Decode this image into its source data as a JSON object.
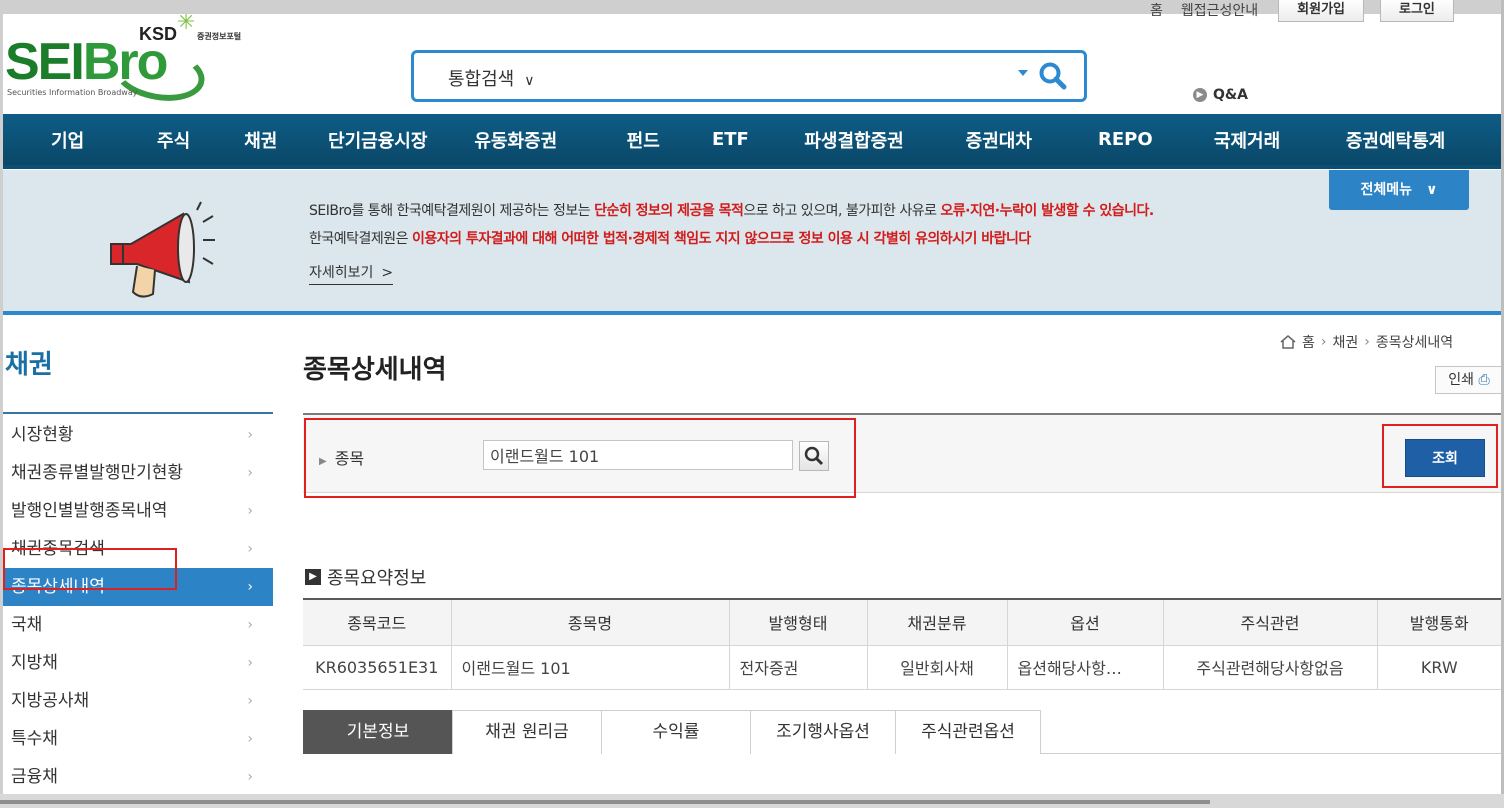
{
  "util": {
    "home": "홈",
    "accessibility": "웹접근성안내",
    "join": "회원가입",
    "login": "로그인"
  },
  "logo": {
    "ksd": "KSD",
    "ksd_sub": "증권정보포털",
    "sei": "SEI",
    "bro": "Bro",
    "tagline": "Securities Information Broadway"
  },
  "search": {
    "scope": "통합검색"
  },
  "qna": "Q&A",
  "gnb": [
    "기업",
    "주식",
    "채권",
    "단기금융시장",
    "유동화증권",
    "펀드",
    "ETF",
    "파생결합증권",
    "증권대차",
    "REPO",
    "국제거래",
    "증권예탁통계"
  ],
  "notice": {
    "l1a": "SEIBro를 통해 한국예탁결제원이 제공하는 정보는 ",
    "l1b": "단순히 정보의 제공을 목적",
    "l1c": "으로 하고 있으며, 불가피한 사유로 ",
    "l1d": "오류·지연·누락이 발생할 수 있습니다.",
    "l2a": "한국예탁결제원은 ",
    "l2b": "이용자의 투자결과에 대해 어떠한 법적·경제적 책임도 지지 않으므로 정보 이용 시 각별히 유의하시기 바랍니다",
    "more": "자세히보기",
    "more_arrow": ">",
    "all_menu": "전체메뉴"
  },
  "side": {
    "title": "채권",
    "items": [
      "시장현황",
      "채권종류별발행만기현황",
      "발행인별발행종목내역",
      "채권종목검색",
      "종목상세내역",
      "국채",
      "지방채",
      "지방공사채",
      "특수채",
      "금융채"
    ],
    "active_index": 4
  },
  "crumb": {
    "home": "홈",
    "section": "채권",
    "page": "종목상세내역"
  },
  "print": "인쇄",
  "page_title": "종목상세내역",
  "filter": {
    "label": "종목",
    "value": "이랜드월드 101",
    "query_button": "조회"
  },
  "summary": {
    "title": "종목요약정보",
    "headers": [
      "종목코드",
      "종목명",
      "발행형태",
      "채권분류",
      "옵션",
      "주식관련",
      "발행통화"
    ],
    "row": [
      "KR6035651E31",
      "이랜드월드 101",
      "전자증권",
      "일반회사채",
      "옵션해당사항…",
      "주식관련해당사항없음",
      "KRW"
    ]
  },
  "tabs": [
    "기본정보",
    "채권 원리금",
    "수익률",
    "조기행사옵션",
    "주식관련옵션"
  ],
  "colors": {
    "nav": "#0e5c86",
    "accent": "#2c83c6",
    "highlight": "#e02020",
    "query": "#1f5fa6"
  }
}
